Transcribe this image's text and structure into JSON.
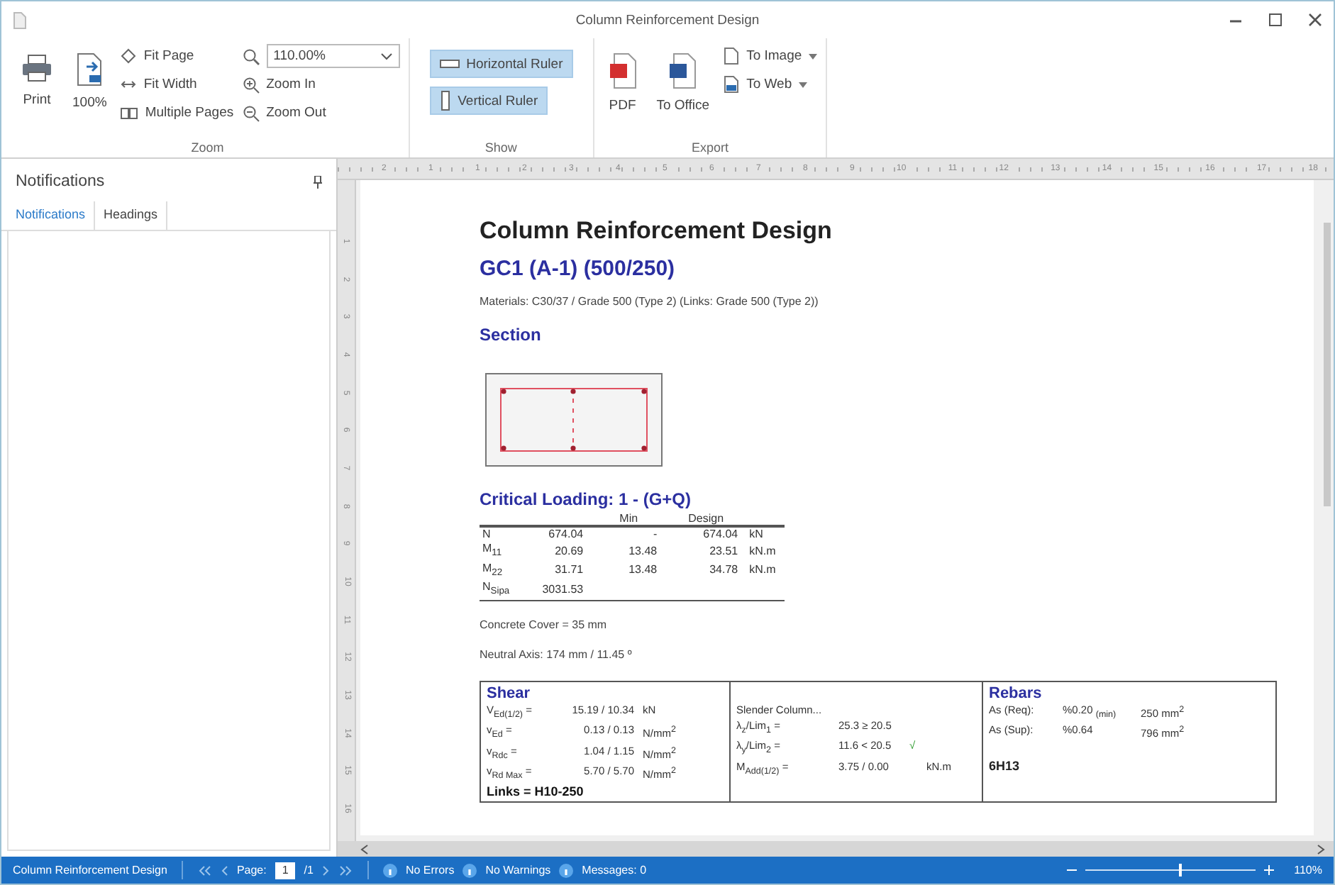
{
  "window": {
    "title": "Column Reinforcement Design"
  },
  "ribbon": {
    "print": "Print",
    "full": "100%",
    "fit_page": "Fit Page",
    "fit_width": "Fit Width",
    "multiple_pages": "Multiple Pages",
    "zoom_value": "110.00%",
    "zoom_in": "Zoom In",
    "zoom_out": "Zoom Out",
    "zoom_group": "Zoom",
    "show": [
      {
        "label": "Horizontal Ruler",
        "on": true
      },
      {
        "label": "Vertical Ruler",
        "on": true
      }
    ],
    "show_group": "Show",
    "pdf": "PDF",
    "to_office": "To Office",
    "to_image": "To Image",
    "to_web": "To Web",
    "export_group": "Export"
  },
  "panel": {
    "title": "Notifications",
    "tabs": [
      {
        "label": "Notifications",
        "selected": true
      },
      {
        "label": "Headings",
        "selected": false
      }
    ]
  },
  "ruler": {
    "h_marks": [
      "2",
      "1",
      "1",
      "2",
      "3",
      "4",
      "5",
      "6",
      "7",
      "8",
      "9",
      "10",
      "11",
      "12",
      "13",
      "14",
      "15",
      "16",
      "17",
      "18"
    ],
    "v_marks": [
      "1",
      "2",
      "3",
      "4",
      "5",
      "6",
      "7",
      "8",
      "9",
      "10",
      "11",
      "12",
      "13",
      "14",
      "15",
      "16"
    ]
  },
  "report": {
    "title": "Column Reinforcement Design",
    "subtitle": "GC1  (A-1) (500/250)",
    "materials": "Materials: C30/37 / Grade 500 (Type 2) (Links: Grade 500 (Type 2))",
    "section_heading": "Section",
    "loading_heading": "Critical Loading: 1 - (G+Q)",
    "loading_columns": [
      "Min",
      "Design"
    ],
    "loading_rows": [
      {
        "name": "N",
        "value": "674.04",
        "min": "-",
        "design": "674.04",
        "unit": "kN"
      },
      {
        "name": "M$_{11}$",
        "value": "20.69",
        "min": "13.48",
        "design": "23.51",
        "unit": "kN.m"
      },
      {
        "name": "M$_{22}$",
        "value": "31.71",
        "min": "13.48",
        "design": "34.78",
        "unit": "kN.m"
      },
      {
        "name": "N$_{Sipa}$",
        "value": "3031.53"
      }
    ],
    "cover": "Concrete Cover = 35 mm",
    "neutral_axis": "Neutral Axis: 174 mm / 11.45 º",
    "shear": {
      "heading": "Shear",
      "rows": [
        {
          "name": "V$_{Ed(1/2)}$ =",
          "value": "15.19 / 10.34",
          "unit": "kN"
        },
        {
          "name": "v$_{Ed}$ =",
          "value": "0.13 / 0.13",
          "unit": "N/mm$^{2}$"
        },
        {
          "name": "v$_{Rdc}$ =",
          "value": "1.04 / 1.15",
          "unit": "N/mm$^{2}$"
        },
        {
          "name": "v$_{Rd Max}$ =",
          "value": "5.70 / 5.70",
          "unit": "N/mm$^{2}$"
        }
      ],
      "links": "Links = H10-250"
    },
    "slender": {
      "heading": "Slender Column...",
      "rows": [
        {
          "name": "λ$_{z}$/Lim$_{1}$ =",
          "value": "25.3 ≥ 20.5"
        },
        {
          "name": "λ$_{y}$/Lim$_{2}$ =",
          "value": "11.6 < 20.5",
          "check": "√"
        },
        {
          "name": "M$_{Add(1/2)}$ =",
          "value": "3.75 / 0.00",
          "unit": "kN.m"
        }
      ]
    },
    "rebars": {
      "heading": "Rebars",
      "rows": [
        {
          "name": "As (Req):",
          "ratio": "%0.20 $_{(min)}$",
          "area": "250 mm$^{2}$"
        },
        {
          "name": "As (Sup):",
          "ratio": "%0.64",
          "area": "796 mm$^{2}$"
        }
      ],
      "bars": "6H13"
    }
  },
  "status_bar": {
    "document": "Column Reinforcement Design",
    "page_label": "Page:",
    "page": "1",
    "page_total": "/1",
    "errors": "No Errors",
    "warnings": "No Warnings",
    "messages": "Messages: 0",
    "zoom_slider": {
      "level": 0.55
    },
    "zoom": "110%"
  }
}
